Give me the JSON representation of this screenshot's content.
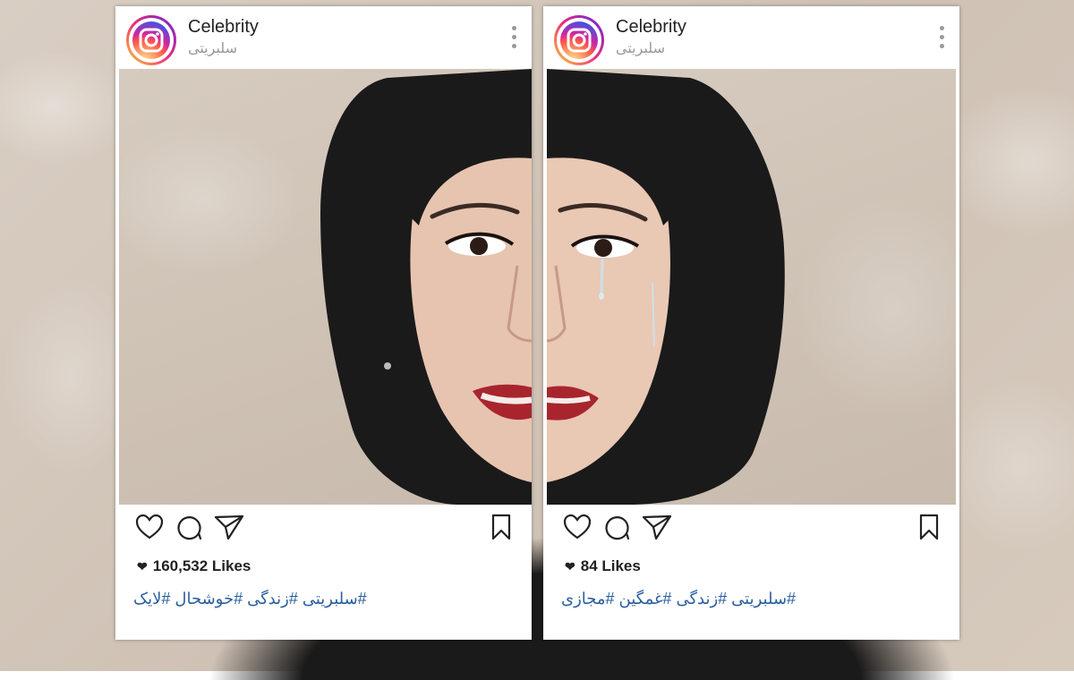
{
  "posts": [
    {
      "username": "Celebrity",
      "subtitle": "سلبریتی",
      "likes": "160,532 Likes",
      "hashtags": "#سلبریتی #زندگی #خوشحال #لایک",
      "mood": "smiling"
    },
    {
      "username": "Celebrity",
      "subtitle": "سلبریتی",
      "likes": "84 Likes",
      "hashtags": "#سلبریتی #زندگی #غمگین #مجازی",
      "mood": "crying"
    }
  ],
  "icons": [
    "instagram-logo-icon",
    "more-options-icon",
    "heart-icon",
    "comment-icon",
    "share-icon",
    "bookmark-icon",
    "heart-filled-icon"
  ],
  "colors": {
    "hashtag": "#2a5f9e",
    "card": "#ffffff",
    "headscarf": "#1b1a1a"
  }
}
